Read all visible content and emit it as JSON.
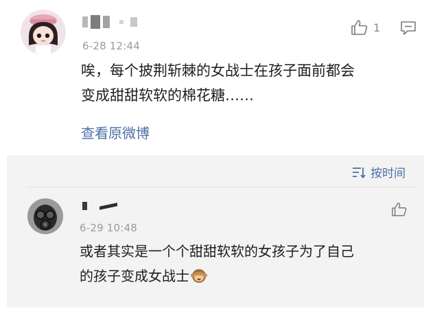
{
  "comment": {
    "timestamp": "6-28 12:44",
    "like_count": "1",
    "text_line_1": "唉，每个披荆斩棘的女战士在孩子面前都会",
    "text_line_2": "变成甜甜软软的棉花糖……",
    "view_original_label": "查看原微博",
    "avatar_icon": "girl-avatar-icon",
    "like_icon": "thumbs-up-icon",
    "reply_icon": "comment-icon"
  },
  "replies": {
    "sort_label": "按时间",
    "sort_icon": "sort-icon",
    "items": [
      {
        "timestamp": "6-29 10:48",
        "text_line_1": "或者其实是一个个甜甜软软的女孩子为了自己",
        "text_line_2": "的孩子变成女战士",
        "emoji": "see-no-evil-monkey-emoji",
        "avatar_icon": "gas-mask-avatar-icon",
        "like_icon": "thumbs-up-icon"
      }
    ]
  },
  "colors": {
    "link": "#4a6fa5",
    "meta": "#9a9a9a",
    "panel_bg": "#f3f3f4"
  }
}
